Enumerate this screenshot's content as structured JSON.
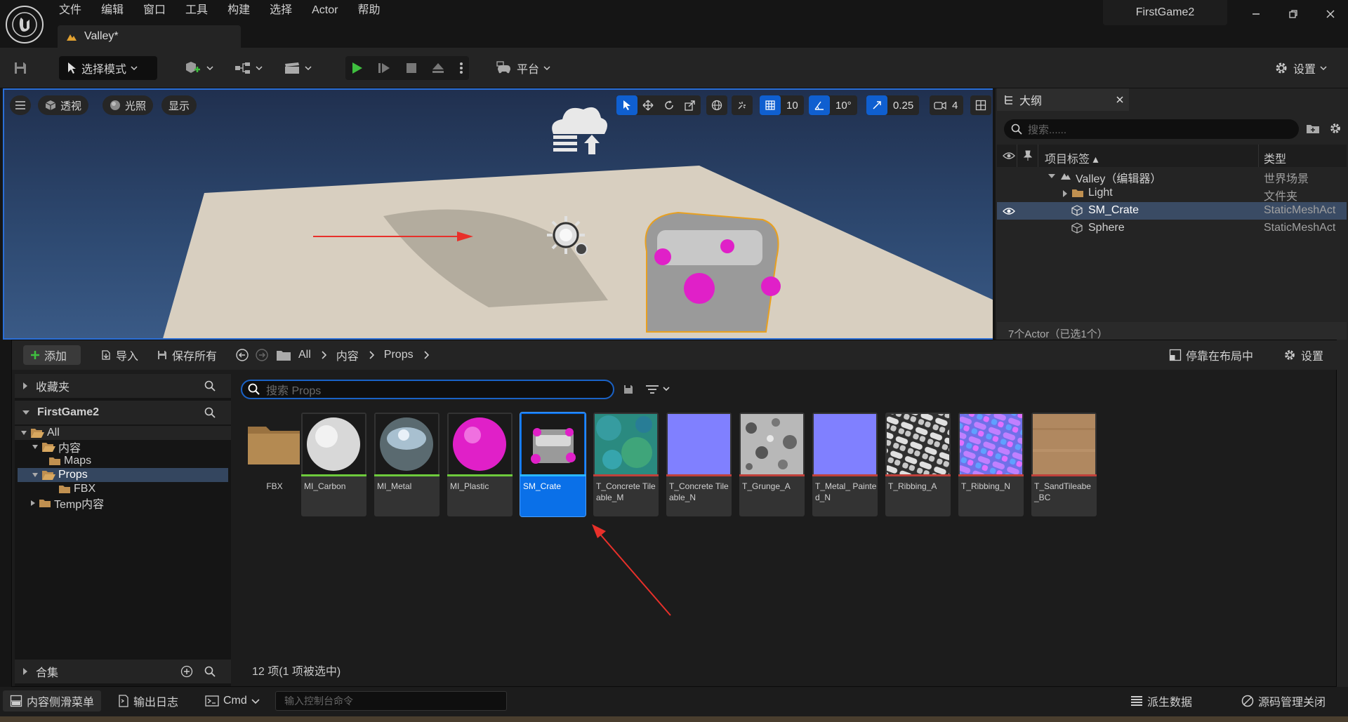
{
  "menu": [
    "文件",
    "编辑",
    "窗口",
    "工具",
    "构建",
    "选择",
    "Actor",
    "帮助"
  ],
  "level_tab": {
    "label": "Valley*"
  },
  "project_name": "FirstGame2",
  "toolbar": {
    "mode_label": "选择模式",
    "platform_label": "平台",
    "settings_label": "设置"
  },
  "viewport": {
    "perspective_label": "透视",
    "lighting_label": "光照",
    "show_label": "显示",
    "grid_snap": "10",
    "rotation_snap": "10°",
    "scale_snap": "0.25",
    "camera_speed": "4"
  },
  "outliner": {
    "tab_label": "大纲",
    "search_placeholder": "搜索......",
    "col_label": "项目标签 ▴",
    "col_type": "类型",
    "rows": [
      {
        "label": "Valley（编辑器）",
        "type": "世界场景"
      },
      {
        "label": "Light",
        "type": "文件夹"
      },
      {
        "label": "SM_Crate",
        "type": "StaticMeshAct"
      },
      {
        "label": "Sphere",
        "type": "StaticMeshAct"
      }
    ],
    "status": "7个Actor（已选1个）"
  },
  "content_browser": {
    "add_label": "添加",
    "import_label": "导入",
    "save_all_label": "保存所有",
    "breadcrumb": [
      "All",
      "内容",
      "Props"
    ],
    "dock_label": "停靠在布局中",
    "settings_label": "设置",
    "favorites_label": "收藏夹",
    "project_label": "FirstGame2",
    "collections_label": "合集",
    "tree": [
      "All",
      "内容",
      "Maps",
      "Props",
      "FBX",
      "Temp内容"
    ],
    "search_placeholder": "搜索 Props",
    "assets": [
      {
        "name": "FBX",
        "kind": "folder"
      },
      {
        "name": "MI_Carbon",
        "kind": "material",
        "color": "#6ecb3c"
      },
      {
        "name": "MI_Metal",
        "kind": "material",
        "color": "#6ecb3c"
      },
      {
        "name": "MI_Plastic",
        "kind": "material",
        "color": "#6ecb3c"
      },
      {
        "name": "SM_Crate",
        "kind": "mesh",
        "color": "#2ab8ff"
      },
      {
        "name": "T_Concrete Tileable_M",
        "kind": "texture",
        "color": "#c0403a"
      },
      {
        "name": "T_Concrete Tileable_N",
        "kind": "texture",
        "color": "#c0403a"
      },
      {
        "name": "T_Grunge_A",
        "kind": "texture",
        "color": "#c0403a"
      },
      {
        "name": "T_Metal_ Painted_N",
        "kind": "texture",
        "color": "#c0403a"
      },
      {
        "name": "T_Ribbing_A",
        "kind": "texture",
        "color": "#c0403a"
      },
      {
        "name": "T_Ribbing_N",
        "kind": "texture",
        "color": "#c0403a"
      },
      {
        "name": "T_SandTileabe _BC",
        "kind": "texture",
        "color": "#c0403a"
      }
    ],
    "count_label": "12 项(1 项被选中)"
  },
  "statusbar": {
    "drawer_label": "内容侧滑菜单",
    "output_label": "输出日志",
    "cmd_label": "Cmd",
    "cmd_placeholder": "输入控制台命令",
    "derived_label": "派生数据",
    "source_label": "源码管理关闭"
  },
  "colors": {
    "accent": "#0f5fd0",
    "selection": "#0a70e8",
    "play": "#3fbf3f",
    "annotation_arrow": "#e8302a"
  }
}
